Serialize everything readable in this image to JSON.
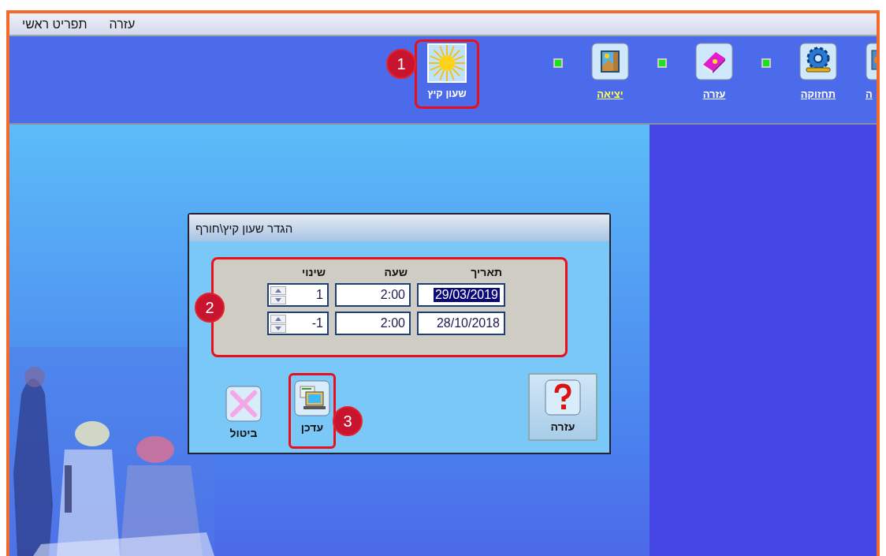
{
  "menu": [
    {
      "label": "עזרה"
    },
    {
      "label": "תפריט ראשי"
    }
  ],
  "toolbar": {
    "featured": {
      "label": "שעון קיץ",
      "callout": "1"
    },
    "links": [
      {
        "kind": "screen",
        "label": "ה",
        "highlighted": false,
        "bullet": false,
        "cut": true
      },
      {
        "kind": "gear",
        "label": "תחזוקה",
        "highlighted": false,
        "bullet": true,
        "cut": false
      },
      {
        "kind": "book",
        "label": "עזרה",
        "highlighted": false,
        "bullet": true,
        "cut": false
      },
      {
        "kind": "door",
        "label": "יציאה",
        "highlighted": true,
        "bullet": true,
        "cut": false
      }
    ]
  },
  "dialog": {
    "title": "הגדר שעון קיץ\\חורף",
    "callout": "2",
    "columns": [
      "תאריך",
      "שעה",
      "שינוי"
    ],
    "rows": [
      {
        "date": "29/03/2019",
        "date_selected": true,
        "time": "2:00",
        "shift": "1"
      },
      {
        "date": "28/10/2018",
        "date_selected": false,
        "time": "2:00",
        "shift": "-1"
      }
    ],
    "buttons": [
      {
        "kind": "help",
        "label": "עזרה"
      },
      {
        "kind": "update",
        "label": "עדכן",
        "callout": "3"
      },
      {
        "kind": "cancel",
        "label": "ביטול"
      }
    ]
  }
}
